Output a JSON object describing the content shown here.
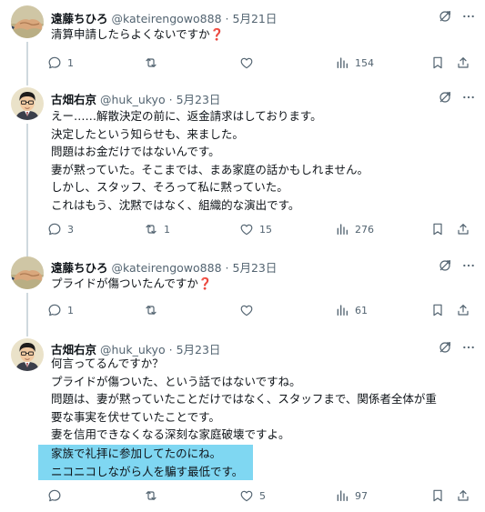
{
  "posts": [
    {
      "display_name": "遠藤ちひろ",
      "handle": "@kateirengowo888",
      "dot": "·",
      "date": "5月21日",
      "lines": [
        "清算申請したらよくないですか❓"
      ],
      "counts": {
        "reply": "1",
        "repost": "",
        "like": "",
        "views": "154"
      },
      "avatar": "handshake-avatar"
    },
    {
      "display_name": "古畑右京",
      "handle": "@huk_ukyo",
      "dot": "·",
      "date": "5月23日",
      "lines": [
        "えー……解散決定の前に、返金請求はしております。",
        "決定したという知らせも、来ました。",
        "問題はお金だけではないんです。",
        "妻が黙っていた。そこまでは、まあ家庭の話かもしれません。",
        "しかし、スタッフ、そろって私に黙っていた。",
        "これはもう、沈黙ではなく、組織的な演出です。"
      ],
      "counts": {
        "reply": "3",
        "repost": "1",
        "like": "15",
        "views": "276"
      },
      "avatar": "detective-avatar"
    },
    {
      "display_name": "遠藤ちひろ",
      "handle": "@kateirengowo888",
      "dot": "·",
      "date": "5月23日",
      "lines": [
        "プライドが傷ついたんですか❓"
      ],
      "counts": {
        "reply": "1",
        "repost": "",
        "like": "",
        "views": "61"
      },
      "avatar": "handshake-avatar"
    },
    {
      "display_name": "古畑右京",
      "handle": "@huk_ukyo",
      "dot": "·",
      "date": "5月23日",
      "lines": [
        "何言ってるんですか？",
        "プライドが傷ついた、という話ではないですね。",
        "問題は、妻が黙っていたことだけではなく、スタッフまで、関係者全体が重",
        "要な事実を伏せていたことです。",
        "妻を信用できなくなる深刻な家庭破壊ですよ。"
      ],
      "highlighted_lines": [
        "家族で礼拝に参加してたのにね。",
        "ニコニコしながら人を騙す最低です。"
      ],
      "highlight_color": "#7fd7f2",
      "counts": {
        "reply": "",
        "repost": "",
        "like": "5",
        "views": "97"
      },
      "avatar": "detective-avatar"
    }
  ],
  "icons": {
    "reply": "reply-icon",
    "repost": "repost-icon",
    "like": "like-icon",
    "views": "views-icon",
    "bookmark": "bookmark-icon",
    "share": "share-icon",
    "grok": "grok-icon",
    "more": "more-icon"
  },
  "colors": {
    "text": "#0f1419",
    "secondary": "#536471",
    "thread_line": "#cfd9de",
    "divider": "#eff3f4",
    "highlight": "#7fd7f2",
    "emoji_red": "#d62a2a"
  }
}
